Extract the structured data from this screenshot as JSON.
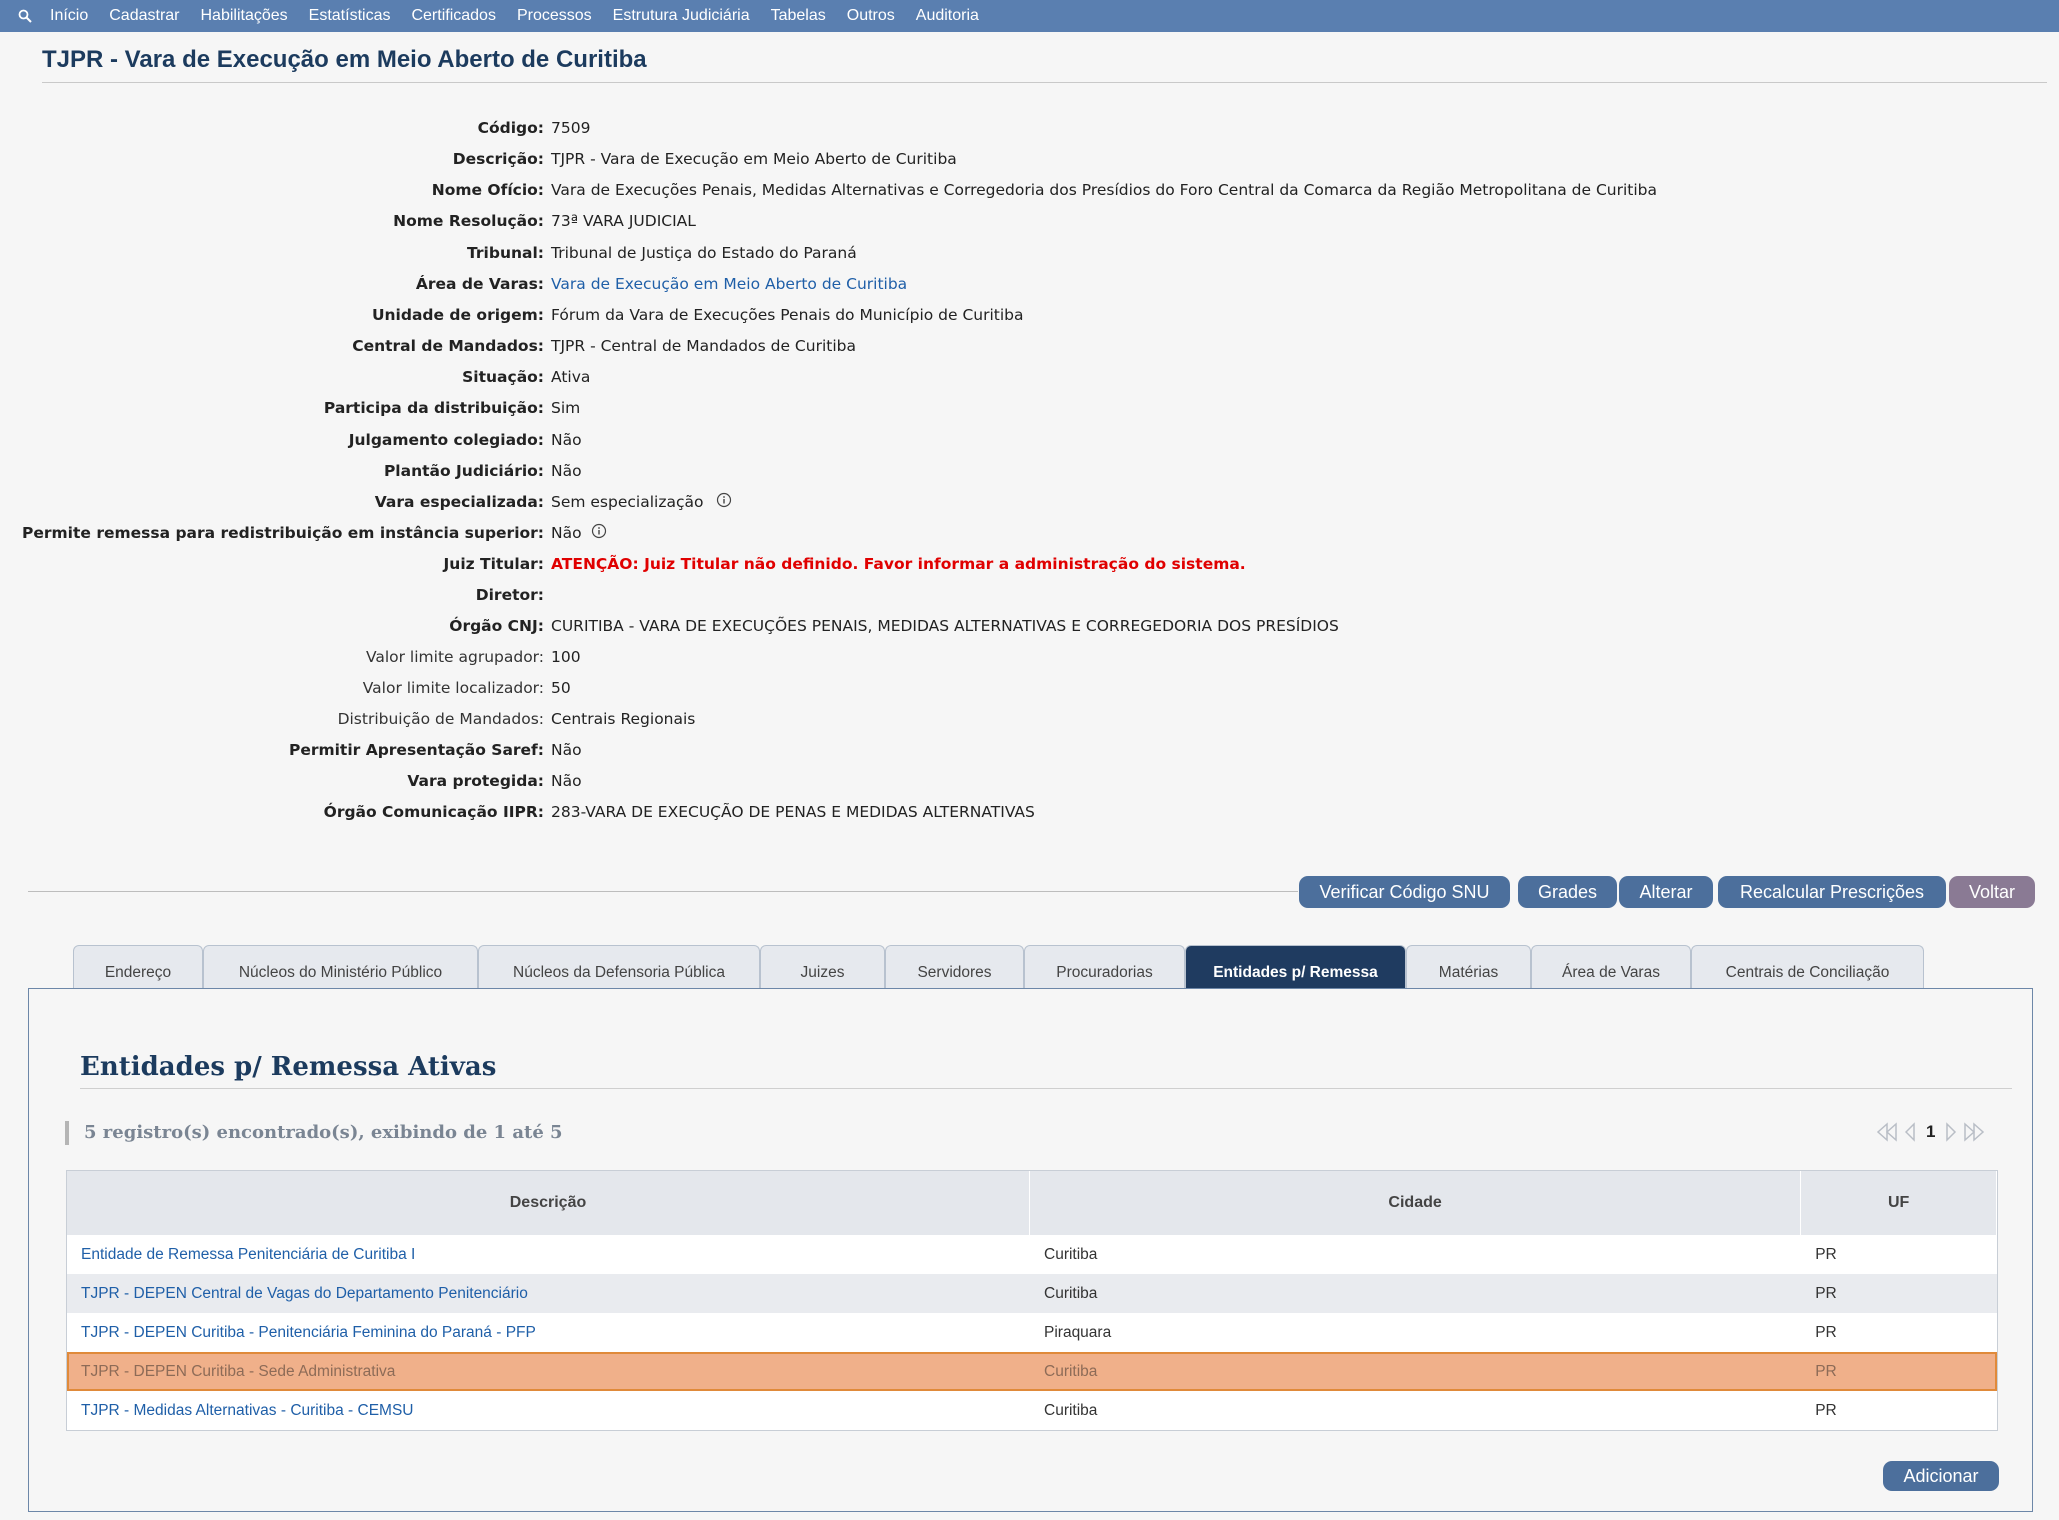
{
  "nav": {
    "items": [
      "Início",
      "Cadastrar",
      "Habilitações",
      "Estatísticas",
      "Certificados",
      "Processos",
      "Estrutura Judiciária",
      "Tabelas",
      "Outros",
      "Auditoria"
    ]
  },
  "page": {
    "title": "TJPR - Vara de Execução em Meio Aberto de Curitiba"
  },
  "details": [
    {
      "label": "Código:",
      "value": "7509"
    },
    {
      "label": "Descrição:",
      "value": "TJPR - Vara de Execução em Meio Aberto de Curitiba"
    },
    {
      "label": "Nome Ofício:",
      "value": "Vara de Execuções Penais, Medidas Alternativas e Corregedoria dos Presídios do Foro Central da Comarca da Região Metropolitana de Curitiba"
    },
    {
      "label": "Nome Resolução:",
      "value": "73ª VARA JUDICIAL"
    },
    {
      "label": "Tribunal:",
      "value": "Tribunal de Justiça do Estado do Paraná"
    },
    {
      "label": "Área de Varas:",
      "value": "Vara de Execução em Meio Aberto de Curitiba"
    },
    {
      "label": "Unidade de origem:",
      "value": "Fórum da Vara de Execuções Penais do Município de Curitiba"
    },
    {
      "label": "Central de Mandados:",
      "value": "TJPR - Central de Mandados de Curitiba"
    },
    {
      "label": "Situação:",
      "value": "Ativa"
    },
    {
      "label": "Participa da distribuição:",
      "value": "Sim"
    },
    {
      "label": "Julgamento colegiado:",
      "value": "Não"
    },
    {
      "label": "Plantão Judiciário:",
      "value": "Não"
    },
    {
      "label": "Vara especializada:",
      "value": "Sem especialização"
    },
    {
      "label": "Permite remessa para redistribuição em instância superior:",
      "value": "Não"
    },
    {
      "label": "Juiz Titular:",
      "value": "ATENÇÃO: Juiz Titular não definido. Favor informar a administração do sistema."
    },
    {
      "label": "Diretor:",
      "value": ""
    },
    {
      "label": "Órgão CNJ:",
      "value": "CURITIBA - VARA DE EXECUÇÕES PENAIS, MEDIDAS ALTERNATIVAS E CORREGEDORIA DOS PRESÍDIOS"
    },
    {
      "label": "Valor limite agrupador:",
      "value": "100"
    },
    {
      "label": "Valor limite localizador:",
      "value": "50"
    },
    {
      "label": "Distribuição de Mandados:",
      "value": "Centrais Regionais"
    },
    {
      "label": "Permitir Apresentação Saref:",
      "value": "Não"
    },
    {
      "label": "Vara protegida:",
      "value": "Não"
    },
    {
      "label": "Órgão Comunicação IIPR:",
      "value": "283-VARA DE EXECUÇÃO DE PENAS E MEDIDAS ALTERNATIVAS"
    }
  ],
  "actions": {
    "verificar": "Verificar Código SNU",
    "grades": "Grades",
    "alterar": "Alterar",
    "recalcular": "Recalcular Prescrições",
    "voltar": "Voltar"
  },
  "tabs": [
    "Endereço",
    "Núcleos do Ministério Público",
    "Núcleos da Defensoria Pública",
    "Juizes",
    "Servidores",
    "Procuradorias",
    "Entidades p/ Remessa",
    "Matérias",
    "Área de Varas",
    "Centrais de Conciliação"
  ],
  "active_tab": "Entidades p/ Remessa",
  "panel": {
    "title": "Entidades p/ Remessa Ativas",
    "count_text": "5 registro(s) encontrado(s), exibindo de 1 até 5",
    "current_page": "1"
  },
  "table": {
    "headers": [
      "Descrição",
      "Cidade",
      "UF"
    ],
    "rows": [
      {
        "descricao": "Entidade de Remessa Penitenciária de Curitiba I",
        "cidade": "Curitiba",
        "uf": "PR"
      },
      {
        "descricao": "TJPR - DEPEN Central de Vagas do Departamento Penitenciário",
        "cidade": "Curitiba",
        "uf": "PR"
      },
      {
        "descricao": "TJPR - DEPEN Curitiba - Penitenciária Feminina do Paraná - PFP",
        "cidade": "Piraquara",
        "uf": "PR"
      },
      {
        "descricao": "TJPR - DEPEN Curitiba - Sede Administrativa",
        "cidade": "Curitiba",
        "uf": "PR"
      },
      {
        "descricao": "TJPR - Medidas Alternativas - Curitiba - CEMSU",
        "cidade": "Curitiba",
        "uf": "PR"
      }
    ]
  },
  "add_label": "Adicionar",
  "colors": {
    "nav": "#5a7fb0",
    "active_tab": "#1f3b60",
    "button": "#4c6f9c",
    "selected_row": "#f0b08a",
    "alert": "#e00000",
    "link": "#1f5fa8"
  }
}
